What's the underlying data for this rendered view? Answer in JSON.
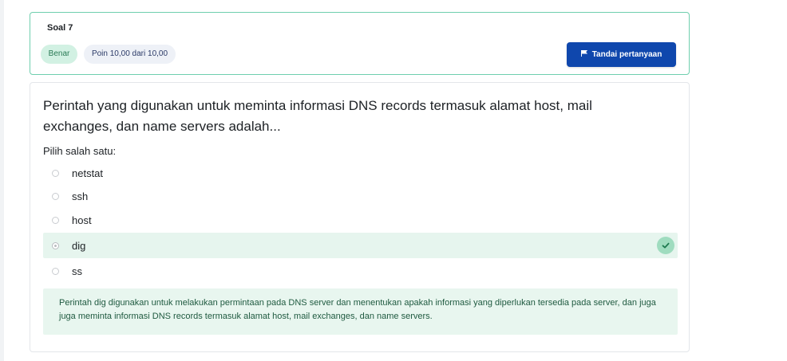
{
  "question": {
    "number_label": "Soal 7",
    "status_badge": "Benar",
    "points_badge": "Poin 10,00 dari 10,00",
    "flag_button": "Tandai pertanyaan",
    "text": "Perintah yang digunakan untuk meminta informasi DNS records termasuk alamat host, mail exchanges, dan name servers adalah...",
    "prompt": "Pilih salah satu:",
    "options": [
      {
        "label": "netstat"
      },
      {
        "label": "ssh"
      },
      {
        "label": "host"
      },
      {
        "label": "dig"
      },
      {
        "label": "ss"
      }
    ],
    "feedback": "Perintah dig digunakan untuk melakukan permintaan pada DNS server dan menentukan apakah informasi yang diperlukan tersedia pada server, dan juga juga meminta informasi DNS records termasuk alamat host, mail exchanges, dan name servers."
  },
  "colors": {
    "accent": "#0f47ad",
    "correct_bg": "#e6f5ee",
    "card_border": "#6fcfae"
  }
}
